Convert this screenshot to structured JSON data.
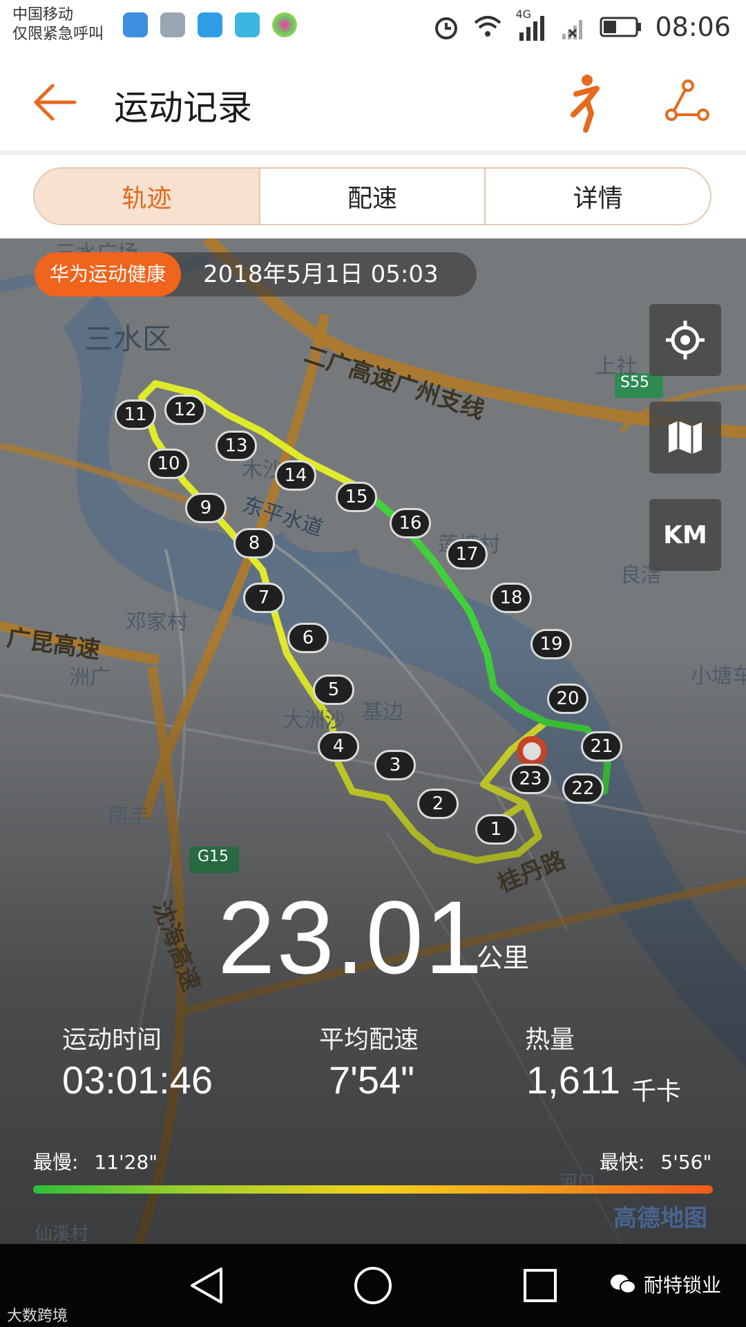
{
  "status_bar": {
    "carrier_line1": "中国移动",
    "carrier_line2": "仅限紧急呼叫",
    "network": "4G",
    "time": "08:06",
    "app_icons": [
      "health-icon",
      "gallery-icon",
      "chart-icon",
      "security-icon",
      "petal-icon"
    ]
  },
  "header": {
    "title": "运动记录",
    "back_icon": "back-arrow-icon",
    "runner_icon": "runner-icon",
    "route_icon": "route-icon"
  },
  "tabs": [
    {
      "label": "轨迹",
      "active": true
    },
    {
      "label": "配速",
      "active": false
    },
    {
      "label": "详情",
      "active": false
    }
  ],
  "map": {
    "source_badge": "华为运动健康",
    "datetime": "2018年5月1日 05:03",
    "controls": {
      "locate_icon": "locate-icon",
      "map_icon": "map-icon",
      "km_label": "KM"
    },
    "labels": {
      "sanshui": "三水区",
      "sanshui_top": "三水广场",
      "expressway": "二广高速广州支线",
      "shangshe": "上社",
      "s55": "S55",
      "musha": "木沙",
      "dongping": "东平水道",
      "liantang": "莲塘村",
      "liangjiao": "良滘",
      "dengjia": "邓家村",
      "dazhousha": "大洲沙",
      "guangkun": "广昆高速",
      "zhouguang": "洲广",
      "xiaotang": "小塘车",
      "jibian": "基边",
      "nanfeng": "南丰",
      "g15": "G15",
      "shenhai": "沈海高速",
      "guidan": "桂丹路",
      "xianxi": "仙溪村",
      "hekou": "河口",
      "amap": "高德地图"
    },
    "km_markers": [
      "1",
      "2",
      "3",
      "4",
      "5",
      "6",
      "7",
      "8",
      "9",
      "10",
      "11",
      "12",
      "13",
      "14",
      "15",
      "16",
      "17",
      "18",
      "19",
      "20",
      "21",
      "22",
      "23"
    ]
  },
  "summary": {
    "distance": "23.01",
    "distance_unit": "公里",
    "duration_label": "运动时间",
    "duration": "03:01:46",
    "pace_label": "平均配速",
    "pace": "7'54\"",
    "calories_label": "热量",
    "calories": "1,611",
    "calories_unit": "千卡",
    "slowest_label": "最慢:",
    "slowest": "11'28\"",
    "fastest_label": "最快:",
    "fastest": "5'56\""
  },
  "nav_bar": {
    "back_icon": "nav-back-icon",
    "home_icon": "nav-home-icon",
    "recent_icon": "nav-recent-icon"
  },
  "watermarks": {
    "right": "耐特锁业",
    "left": "大数跨境"
  }
}
